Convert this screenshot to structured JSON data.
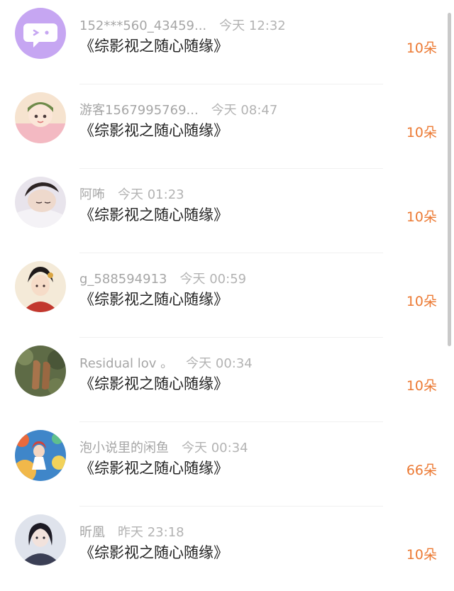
{
  "rows": [
    {
      "user": "152***560_43459...",
      "time": "今天 12:32",
      "title": "《综影视之随心随缘》",
      "amount": "10朵",
      "avatar": "default-chat-avatar"
    },
    {
      "user": "游客1567995769...",
      "time": "今天 08:47",
      "title": "《综影视之随心随缘》",
      "amount": "10朵",
      "avatar": "cartoon-girl-avatar"
    },
    {
      "user": "阿咘",
      "time": "今天 01:23",
      "title": "《综影视之随心随缘》",
      "amount": "10朵",
      "avatar": "sleeping-person-avatar"
    },
    {
      "user": "g_588594913",
      "time": "今天 00:59",
      "title": "《综影视之随心随缘》",
      "amount": "10朵",
      "avatar": "ancient-costume-avatar"
    },
    {
      "user": "Residual lov 。",
      "time": "今天 00:34",
      "title": "《综影视之随心随缘》",
      "amount": "10朵",
      "avatar": "shoes-photo-avatar"
    },
    {
      "user": "泡小说里的闲鱼",
      "time": "今天 00:34",
      "title": "《综影视之随心随缘》",
      "amount": "66朵",
      "avatar": "colorful-illustration-avatar"
    },
    {
      "user": "昕凰",
      "time": "昨天 23:18",
      "title": "《综影视之随心随缘》",
      "amount": "10朵",
      "avatar": "dark-hair-girl-avatar"
    }
  ],
  "colors": {
    "accent": "#ec7a34",
    "meta": "#a6a6a6",
    "title": "#222222",
    "default_avatar_bg": "#c6a6f2"
  }
}
